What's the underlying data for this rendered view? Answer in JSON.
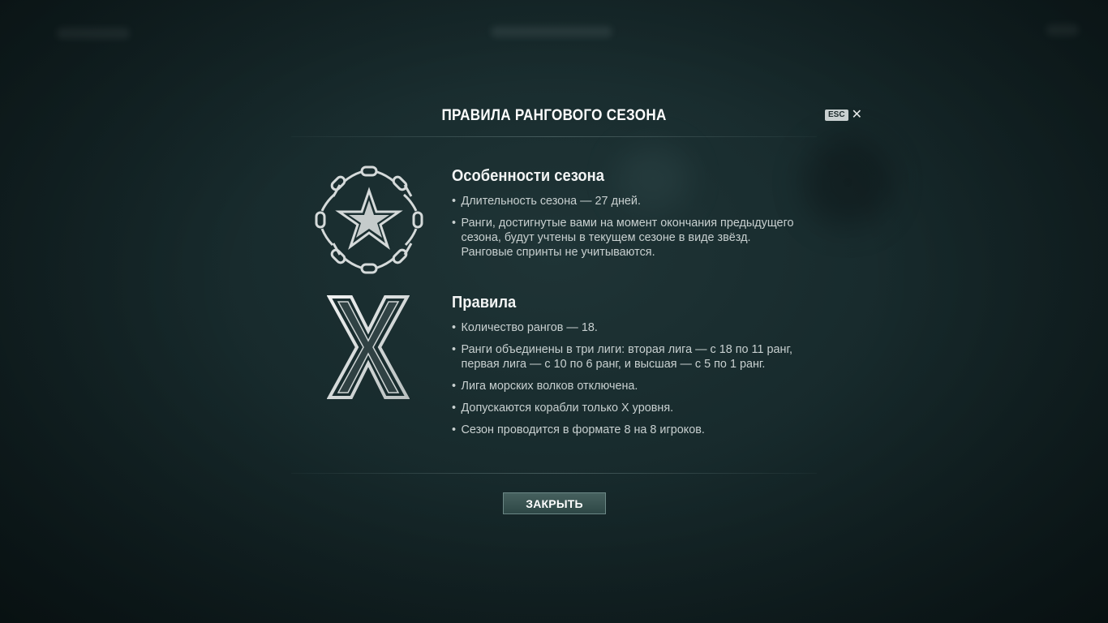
{
  "dialog": {
    "title": "ПРАВИЛА РАНГОВОГО СЕЗОНА",
    "esc_label": "ESC",
    "close_glyph": "✕",
    "close_button_label": "ЗАКРЫТЬ"
  },
  "season": {
    "icon": "star-chain-icon",
    "heading": "Особенности сезона",
    "items": [
      "Длительность сезона — 27 дней.",
      "Ранги, достигнутые вами на момент окончания предыдущего сезона, будут учтены в текущем сезоне в виде звёзд. Ранговые спринты не учитываются."
    ]
  },
  "rules": {
    "icon": "tier-x-icon",
    "heading": "Правила",
    "items": [
      "Количество рангов — 18.",
      "Ранги объединены в три лиги: вторая лига — с 18 по 11 ранг, первая лига — с 10 по 6 ранг, и высшая — с 5 по 1 ранг.",
      "Лига морских волков отключена.",
      "Допускаются корабли только X уровня.",
      "Сезон проводится в формате 8 на 8 игроков."
    ]
  }
}
